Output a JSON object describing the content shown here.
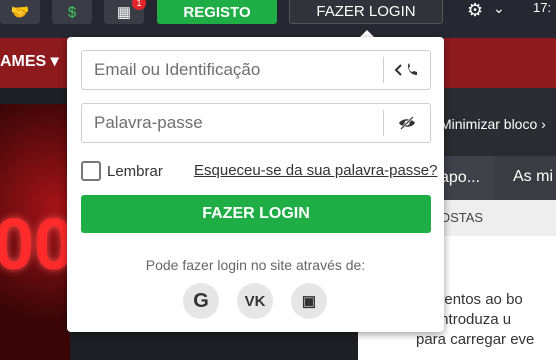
{
  "header": {
    "register_label": "REGISTO",
    "login_label": "FAZER LOGIN",
    "clock_text": "17:",
    "gift_badge": "1"
  },
  "nav": {
    "games_label": "AMES ▾"
  },
  "banner": {
    "text": "00"
  },
  "sidebar": {
    "minimize_label": "Minimizar bloco ›",
    "tab_active": "apo...",
    "tab_2": "As mi",
    "bets_label": "OSTAS",
    "message_lines": [
      "e eventos ao bo",
      "ou introduza u",
      "para carregar eve"
    ]
  },
  "login_popup": {
    "email_placeholder": "Email ou Identificação",
    "password_placeholder": "Palavra-passe",
    "remember_label": "Lembrar",
    "forgot_label": "Esqueceu-se da sua palavra-passe?",
    "submit_label": "FAZER LOGIN",
    "social_hint": "Pode fazer login no site através de:",
    "social": [
      {
        "icon": "google-icon",
        "glyph": "G"
      },
      {
        "icon": "vk-icon",
        "glyph": "VK"
      },
      {
        "icon": "twitch-icon",
        "glyph": "▣"
      }
    ]
  },
  "colors": {
    "accent_green": "#1fae46",
    "nav_red": "#8e1a1d",
    "header_dark": "#252830"
  }
}
